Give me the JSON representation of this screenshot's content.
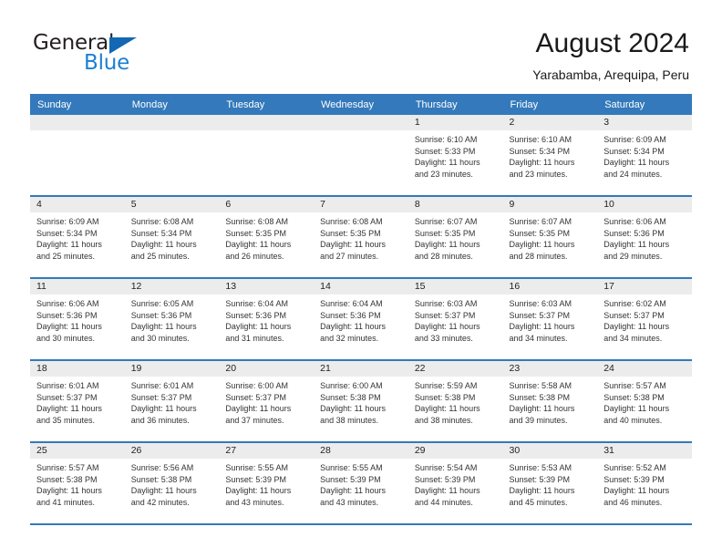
{
  "brand": {
    "name_top": "General",
    "name_bottom": "Blue",
    "triangle_color": "#1268b3",
    "blue_color": "#1c7fd4"
  },
  "header": {
    "title": "August 2024",
    "subtitle": "Yarabamba, Arequipa, Peru"
  },
  "theme": {
    "header_blue": "#3479bb",
    "daynum_band": "#ececec",
    "text": "#333333"
  },
  "weekdays": [
    "Sunday",
    "Monday",
    "Tuesday",
    "Wednesday",
    "Thursday",
    "Friday",
    "Saturday"
  ],
  "weeks": [
    [
      {
        "day": "",
        "sunrise": "",
        "sunset": "",
        "daylight1": "",
        "daylight2": ""
      },
      {
        "day": "",
        "sunrise": "",
        "sunset": "",
        "daylight1": "",
        "daylight2": ""
      },
      {
        "day": "",
        "sunrise": "",
        "sunset": "",
        "daylight1": "",
        "daylight2": ""
      },
      {
        "day": "",
        "sunrise": "",
        "sunset": "",
        "daylight1": "",
        "daylight2": ""
      },
      {
        "day": "1",
        "sunrise": "Sunrise: 6:10 AM",
        "sunset": "Sunset: 5:33 PM",
        "daylight1": "Daylight: 11 hours",
        "daylight2": "and 23 minutes."
      },
      {
        "day": "2",
        "sunrise": "Sunrise: 6:10 AM",
        "sunset": "Sunset: 5:34 PM",
        "daylight1": "Daylight: 11 hours",
        "daylight2": "and 23 minutes."
      },
      {
        "day": "3",
        "sunrise": "Sunrise: 6:09 AM",
        "sunset": "Sunset: 5:34 PM",
        "daylight1": "Daylight: 11 hours",
        "daylight2": "and 24 minutes."
      }
    ],
    [
      {
        "day": "4",
        "sunrise": "Sunrise: 6:09 AM",
        "sunset": "Sunset: 5:34 PM",
        "daylight1": "Daylight: 11 hours",
        "daylight2": "and 25 minutes."
      },
      {
        "day": "5",
        "sunrise": "Sunrise: 6:08 AM",
        "sunset": "Sunset: 5:34 PM",
        "daylight1": "Daylight: 11 hours",
        "daylight2": "and 25 minutes."
      },
      {
        "day": "6",
        "sunrise": "Sunrise: 6:08 AM",
        "sunset": "Sunset: 5:35 PM",
        "daylight1": "Daylight: 11 hours",
        "daylight2": "and 26 minutes."
      },
      {
        "day": "7",
        "sunrise": "Sunrise: 6:08 AM",
        "sunset": "Sunset: 5:35 PM",
        "daylight1": "Daylight: 11 hours",
        "daylight2": "and 27 minutes."
      },
      {
        "day": "8",
        "sunrise": "Sunrise: 6:07 AM",
        "sunset": "Sunset: 5:35 PM",
        "daylight1": "Daylight: 11 hours",
        "daylight2": "and 28 minutes."
      },
      {
        "day": "9",
        "sunrise": "Sunrise: 6:07 AM",
        "sunset": "Sunset: 5:35 PM",
        "daylight1": "Daylight: 11 hours",
        "daylight2": "and 28 minutes."
      },
      {
        "day": "10",
        "sunrise": "Sunrise: 6:06 AM",
        "sunset": "Sunset: 5:36 PM",
        "daylight1": "Daylight: 11 hours",
        "daylight2": "and 29 minutes."
      }
    ],
    [
      {
        "day": "11",
        "sunrise": "Sunrise: 6:06 AM",
        "sunset": "Sunset: 5:36 PM",
        "daylight1": "Daylight: 11 hours",
        "daylight2": "and 30 minutes."
      },
      {
        "day": "12",
        "sunrise": "Sunrise: 6:05 AM",
        "sunset": "Sunset: 5:36 PM",
        "daylight1": "Daylight: 11 hours",
        "daylight2": "and 30 minutes."
      },
      {
        "day": "13",
        "sunrise": "Sunrise: 6:04 AM",
        "sunset": "Sunset: 5:36 PM",
        "daylight1": "Daylight: 11 hours",
        "daylight2": "and 31 minutes."
      },
      {
        "day": "14",
        "sunrise": "Sunrise: 6:04 AM",
        "sunset": "Sunset: 5:36 PM",
        "daylight1": "Daylight: 11 hours",
        "daylight2": "and 32 minutes."
      },
      {
        "day": "15",
        "sunrise": "Sunrise: 6:03 AM",
        "sunset": "Sunset: 5:37 PM",
        "daylight1": "Daylight: 11 hours",
        "daylight2": "and 33 minutes."
      },
      {
        "day": "16",
        "sunrise": "Sunrise: 6:03 AM",
        "sunset": "Sunset: 5:37 PM",
        "daylight1": "Daylight: 11 hours",
        "daylight2": "and 34 minutes."
      },
      {
        "day": "17",
        "sunrise": "Sunrise: 6:02 AM",
        "sunset": "Sunset: 5:37 PM",
        "daylight1": "Daylight: 11 hours",
        "daylight2": "and 34 minutes."
      }
    ],
    [
      {
        "day": "18",
        "sunrise": "Sunrise: 6:01 AM",
        "sunset": "Sunset: 5:37 PM",
        "daylight1": "Daylight: 11 hours",
        "daylight2": "and 35 minutes."
      },
      {
        "day": "19",
        "sunrise": "Sunrise: 6:01 AM",
        "sunset": "Sunset: 5:37 PM",
        "daylight1": "Daylight: 11 hours",
        "daylight2": "and 36 minutes."
      },
      {
        "day": "20",
        "sunrise": "Sunrise: 6:00 AM",
        "sunset": "Sunset: 5:37 PM",
        "daylight1": "Daylight: 11 hours",
        "daylight2": "and 37 minutes."
      },
      {
        "day": "21",
        "sunrise": "Sunrise: 6:00 AM",
        "sunset": "Sunset: 5:38 PM",
        "daylight1": "Daylight: 11 hours",
        "daylight2": "and 38 minutes."
      },
      {
        "day": "22",
        "sunrise": "Sunrise: 5:59 AM",
        "sunset": "Sunset: 5:38 PM",
        "daylight1": "Daylight: 11 hours",
        "daylight2": "and 38 minutes."
      },
      {
        "day": "23",
        "sunrise": "Sunrise: 5:58 AM",
        "sunset": "Sunset: 5:38 PM",
        "daylight1": "Daylight: 11 hours",
        "daylight2": "and 39 minutes."
      },
      {
        "day": "24",
        "sunrise": "Sunrise: 5:57 AM",
        "sunset": "Sunset: 5:38 PM",
        "daylight1": "Daylight: 11 hours",
        "daylight2": "and 40 minutes."
      }
    ],
    [
      {
        "day": "25",
        "sunrise": "Sunrise: 5:57 AM",
        "sunset": "Sunset: 5:38 PM",
        "daylight1": "Daylight: 11 hours",
        "daylight2": "and 41 minutes."
      },
      {
        "day": "26",
        "sunrise": "Sunrise: 5:56 AM",
        "sunset": "Sunset: 5:38 PM",
        "daylight1": "Daylight: 11 hours",
        "daylight2": "and 42 minutes."
      },
      {
        "day": "27",
        "sunrise": "Sunrise: 5:55 AM",
        "sunset": "Sunset: 5:39 PM",
        "daylight1": "Daylight: 11 hours",
        "daylight2": "and 43 minutes."
      },
      {
        "day": "28",
        "sunrise": "Sunrise: 5:55 AM",
        "sunset": "Sunset: 5:39 PM",
        "daylight1": "Daylight: 11 hours",
        "daylight2": "and 43 minutes."
      },
      {
        "day": "29",
        "sunrise": "Sunrise: 5:54 AM",
        "sunset": "Sunset: 5:39 PM",
        "daylight1": "Daylight: 11 hours",
        "daylight2": "and 44 minutes."
      },
      {
        "day": "30",
        "sunrise": "Sunrise: 5:53 AM",
        "sunset": "Sunset: 5:39 PM",
        "daylight1": "Daylight: 11 hours",
        "daylight2": "and 45 minutes."
      },
      {
        "day": "31",
        "sunrise": "Sunrise: 5:52 AM",
        "sunset": "Sunset: 5:39 PM",
        "daylight1": "Daylight: 11 hours",
        "daylight2": "and 46 minutes."
      }
    ]
  ]
}
